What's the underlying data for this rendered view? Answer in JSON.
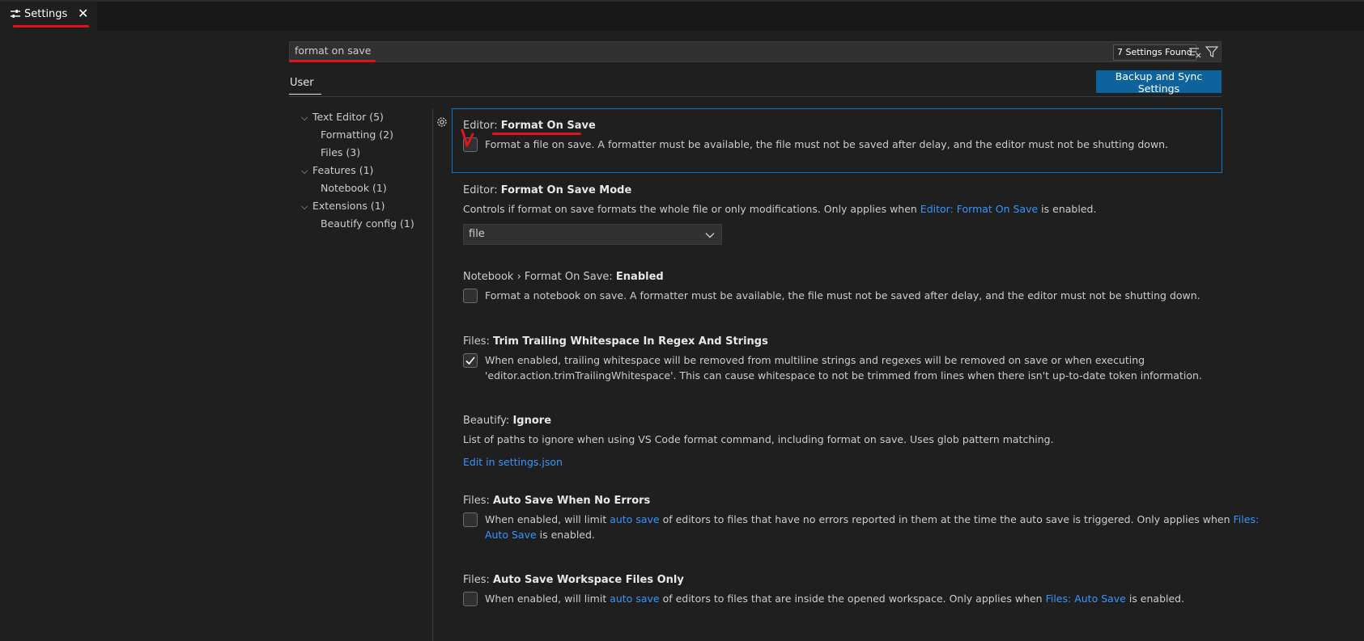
{
  "tab": {
    "label": "Settings",
    "icon": "settings-sliders-icon",
    "close_icon": "close-icon"
  },
  "search": {
    "value": "format on save",
    "count_label": "7 Settings Found"
  },
  "scope_tab": {
    "label": "User"
  },
  "sync_button": {
    "label": "Backup and Sync Settings"
  },
  "toc": [
    {
      "label": "Text Editor (5)"
    },
    {
      "label": "Formatting (2)"
    },
    {
      "label": "Files (3)"
    },
    {
      "label": "Features (1)"
    },
    {
      "label": "Notebook (1)"
    },
    {
      "label": "Extensions (1)"
    },
    {
      "label": "Beautify config (1)"
    }
  ],
  "settings": {
    "format_on_save": {
      "category": "Editor: ",
      "name": "Format On Save",
      "checked": false,
      "description": "Format a file on save. A formatter must be available, the file must not be saved after delay, and the editor must not be shutting down."
    },
    "format_on_save_mode": {
      "category": "Editor: ",
      "name": "Format On Save Mode",
      "desc_before": "Controls if format on save formats the whole file or only modifications. Only applies when ",
      "desc_link": "Editor: Format On Save",
      "desc_after": " is enabled.",
      "value": "file"
    },
    "notebook_format_on_save": {
      "category": "Notebook › Format On Save: ",
      "name": "Enabled",
      "checked": false,
      "description": "Format a notebook on save. A formatter must be available, the file must not be saved after delay, and the editor must not be shutting down."
    },
    "trim_trailing_whitespace": {
      "category": "Files: ",
      "name": "Trim Trailing Whitespace In Regex And Strings",
      "checked": true,
      "description_line1": "When enabled, trailing whitespace will be removed from multiline strings and regexes will be removed on save or when executing",
      "description_line2": "'editor.action.trimTrailingWhitespace'. This can cause whitespace to not be trimmed from lines when there isn't up-to-date token information."
    },
    "beautify_ignore": {
      "category": "Beautify: ",
      "name": "Ignore",
      "description": "List of paths to ignore when using VS Code format command, including format on save. Uses glob pattern matching.",
      "link": "Edit in settings.json"
    },
    "auto_save_no_errors": {
      "category": "Files: ",
      "name": "Auto Save When No Errors",
      "checked": false,
      "desc_before": "When enabled, will limit ",
      "desc_link1": "auto save",
      "desc_middle": " of editors to files that have no errors reported in them at the time the auto save is triggered. Only applies when ",
      "desc_link2a": "Files:",
      "desc_link2b": "Auto Save",
      "desc_after": " is enabled."
    },
    "auto_save_workspace_only": {
      "category": "Files: ",
      "name": "Auto Save Workspace Files Only",
      "checked": false,
      "desc_before": "When enabled, will limit ",
      "desc_link1": "auto save",
      "desc_middle": " of editors to files that are inside the opened workspace. Only applies when ",
      "desc_link2": "Files: Auto Save",
      "desc_after": " is enabled."
    }
  },
  "colors": {
    "accent": "#0078d4",
    "link": "#3794ff",
    "annotation": "#e0141a",
    "button": "#0e639c"
  }
}
